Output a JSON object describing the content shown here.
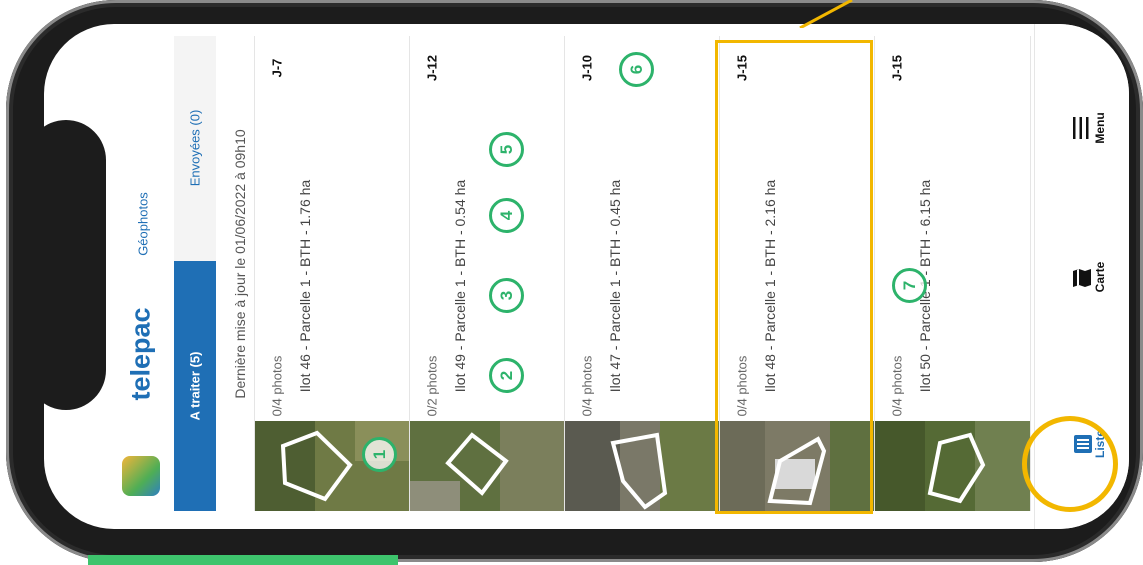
{
  "app": {
    "brand": "telepac",
    "module": "Géophotos"
  },
  "tabs": [
    {
      "label": "A traiter (5)",
      "active": true
    },
    {
      "label": "Envoyées (0)",
      "active": false
    }
  ],
  "last_update": "Dernière mise à jour le 01/06/2022 à 09h10",
  "cards": [
    {
      "photos": "0/4 photos",
      "parcel": "Ilot 46 - Parcelle 1 - BTH - 1.76 ha",
      "due": "J-7"
    },
    {
      "photos": "0/2 photos",
      "parcel": "Ilot 49 - Parcelle 1 - BTH - 0.54 ha",
      "due": "J-12"
    },
    {
      "photos": "0/4 photos",
      "parcel": "Ilot 47 - Parcelle 1 - BTH - 0.45 ha",
      "due": "J-10"
    },
    {
      "photos": "0/4 photos",
      "parcel": "Ilot 48 - Parcelle 1 - BTH - 2.16 ha",
      "due": "J-15"
    },
    {
      "photos": "0/4 photos",
      "parcel": "Ilot 50 - Parcelle 1 - BTH - 6.15 ha",
      "due": "J-15"
    }
  ],
  "bottom_nav": [
    {
      "label": "Liste",
      "icon": "list-icon",
      "active": true
    },
    {
      "label": "Carte",
      "icon": "map-icon",
      "active": false
    },
    {
      "label": "Menu",
      "icon": "hamburger-icon",
      "active": false
    }
  ],
  "annotations": [
    "1",
    "2",
    "3",
    "4",
    "5",
    "6",
    "7"
  ],
  "colors": {
    "brand_blue": "#1f6fb5",
    "highlight_yellow": "#f2b700",
    "annotation_green": "#2db36b"
  }
}
